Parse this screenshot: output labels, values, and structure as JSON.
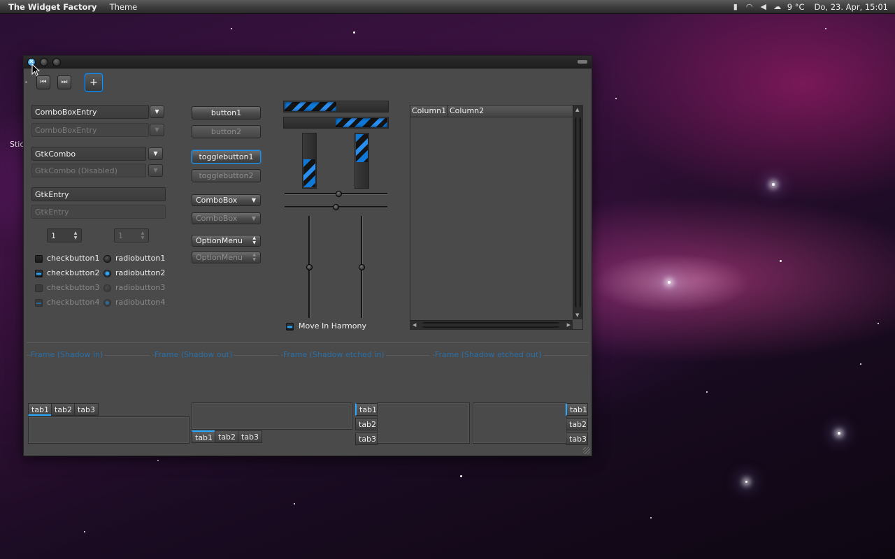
{
  "panel": {
    "app_title": "The Widget Factory",
    "menu_theme": "Theme",
    "weather": "9 °C",
    "datetime": "Do, 23. Apr, 15:01"
  },
  "desktop": {
    "partial_label": "Stic"
  },
  "window": {
    "close_glyph": "✕",
    "toolbar": {
      "first_glyph": "⏮",
      "last_glyph": "⏭",
      "add_glyph": "+"
    }
  },
  "left": {
    "comboboxentry": "ComboBoxEntry",
    "comboboxentry_disabled": "ComboBoxEntry",
    "gtkcombo": "GtkCombo",
    "gtkcombo_disabled": "GtkCombo (Disabled)",
    "gtkentry": "GtkEntry",
    "gtkentry_placeholder": "GtkEntry",
    "spin1": "1",
    "spin2": "1",
    "checks": [
      {
        "label": "checkbutton1"
      },
      {
        "label": "checkbutton2"
      },
      {
        "label": "checkbutton3"
      },
      {
        "label": "checkbutton4"
      }
    ],
    "radios": [
      {
        "label": "radiobutton1"
      },
      {
        "label": "radiobutton2"
      },
      {
        "label": "radiobutton3"
      },
      {
        "label": "radiobutton4"
      }
    ]
  },
  "buttons": {
    "button1": "button1",
    "button2": "button2",
    "toggle1": "togglebutton1",
    "toggle2": "togglebutton2",
    "combobox1": "ComboBox",
    "combobox2": "ComboBox",
    "optionmenu1": "OptionMenu",
    "optionmenu2": "OptionMenu"
  },
  "middle": {
    "move_in_harmony": "Move In Harmony"
  },
  "tree": {
    "columns": [
      "Column1",
      "Column2"
    ]
  },
  "frames": [
    "Frame (Shadow in)",
    "Frame (Shadow out)",
    "Frame (Shadow etched in)",
    "Frame (Shadow etched out)"
  ],
  "notebooks": {
    "tabs": [
      "tab1",
      "tab2",
      "tab3"
    ]
  },
  "colors": {
    "accent": "#29a8ff",
    "frame_label": "#2a6fa8",
    "window_bg": "#4a4a4a"
  }
}
